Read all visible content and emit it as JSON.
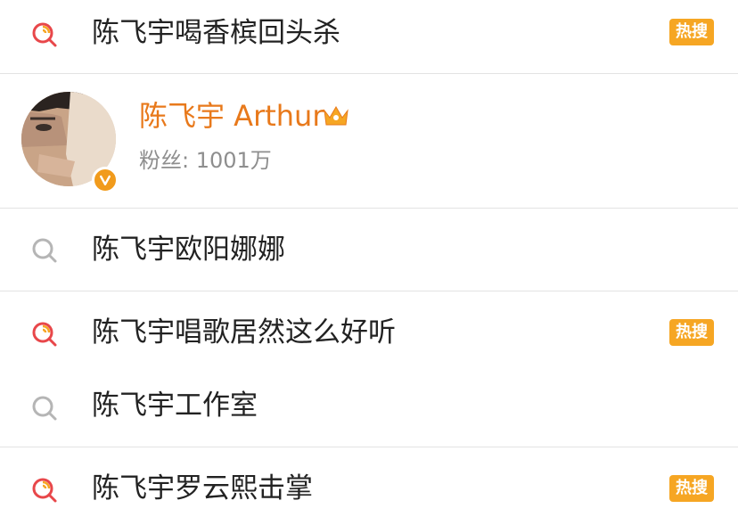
{
  "badge_hot": "热搜",
  "items": [
    {
      "text": "陈飞宇喝香槟回头杀",
      "hot": true
    },
    {
      "text": "陈飞宇欧阳娜娜",
      "hot": false
    },
    {
      "text": "陈飞宇唱歌居然这么好听",
      "hot": true
    },
    {
      "text": "陈飞宇工作室",
      "hot": false
    },
    {
      "text": "陈飞宇罗云熙击掌",
      "hot": true
    }
  ],
  "profile": {
    "name": "陈飞宇 Arthur",
    "fans": "粉丝: 1001万",
    "verified_icon": "verified-v-badge",
    "crown_icon": "crown-icon"
  },
  "colors": {
    "accent_orange": "#e8791b",
    "badge_orange": "#f6a623",
    "hot_icon_red": "#e8474a",
    "hot_icon_orange": "#f6a623",
    "gray_icon": "#b5b5b5"
  }
}
